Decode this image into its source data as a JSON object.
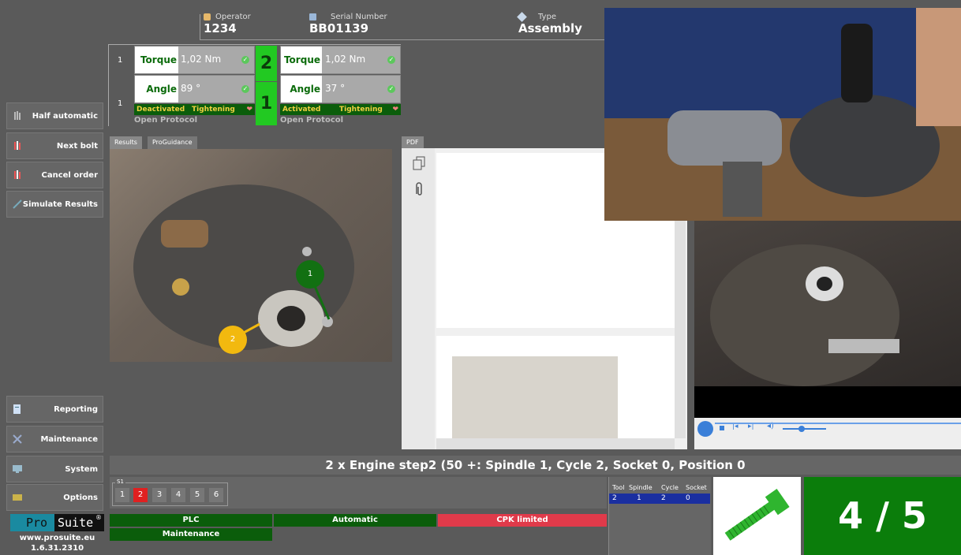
{
  "header": {
    "operator_label": "Operator",
    "operator_value": "1234",
    "serial_label": "Serial Number",
    "serial_value": "BB01139",
    "type_label": "Type",
    "type_value": "Assembly"
  },
  "sidebar": {
    "half_automatic": "Half automatic",
    "next_bolt": "Next bolt",
    "cancel_order": "Cancel order",
    "simulate_results": "Simulate Results",
    "reporting": "Reporting",
    "maintenance": "Maintenance",
    "system": "System",
    "options": "Options"
  },
  "spindles": {
    "row1_index": "1",
    "row2_index": "1",
    "left": {
      "torque_label": "Torque",
      "torque_value": "1,02 Nm",
      "angle_label": "Angle",
      "angle_value": "89 °",
      "state": "Deactivated",
      "mode": "Tightening",
      "protocol": "Open Protocol"
    },
    "big_top": "2",
    "big_bottom": "1",
    "right": {
      "torque_label": "Torque",
      "torque_value": "1,02 Nm",
      "angle_label": "Angle",
      "angle_value": "37 °",
      "state": "Activated",
      "mode": "Tightening",
      "protocol": "Open Protocol"
    }
  },
  "tabs": {
    "results": "Results",
    "proguidance": "ProGuidance",
    "pdf": "PDF"
  },
  "markers": {
    "m1": "1",
    "m2": "2"
  },
  "step": {
    "title": "2 x Engine step2 (50 +: Spindle  1, Cycle 2, Socket 0, Position 0"
  },
  "cycles": {
    "group_label": "S1",
    "items": [
      "1",
      "2",
      "3",
      "4",
      "5",
      "6"
    ],
    "active_index": 1
  },
  "status": {
    "plc": "PLC",
    "automatic": "Automatic",
    "cpk": "CPK limited",
    "maintenance": "Maintenance"
  },
  "tool_table": {
    "headers": [
      "Tool",
      "Spindle",
      "Cycle",
      "Socket"
    ],
    "values": [
      "2",
      "1",
      "2",
      "0"
    ]
  },
  "brand": {
    "name_a": "Pro",
    "name_b": "Suite",
    "reg": "®",
    "url": "www.prosuite.eu",
    "version": "1.6.31.2310"
  },
  "counter": "4 / 5",
  "colors": {
    "accent_green": "#0b7d0b",
    "bright_green": "#22c922",
    "dark_green": "#0b5d0b",
    "status_red": "#e03a4a",
    "marker_green": "#127012",
    "marker_yellow": "#f2b90f",
    "active_cycle_red": "#e02020"
  }
}
